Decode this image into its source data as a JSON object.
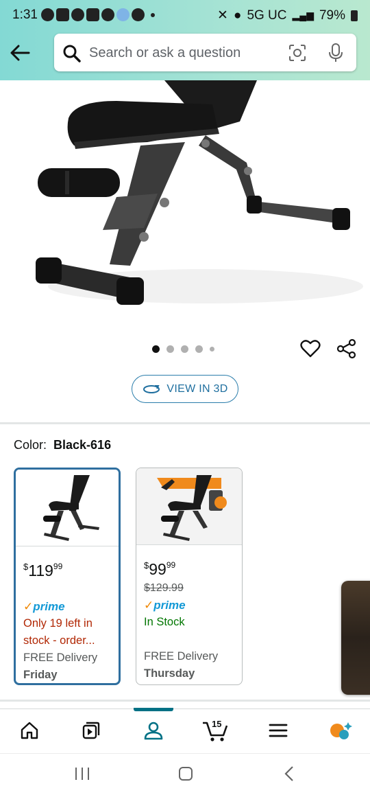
{
  "status_bar": {
    "time": "1:31",
    "network": "5G UC",
    "battery": "79%"
  },
  "search": {
    "placeholder": "Search or ask a question"
  },
  "gallery": {
    "image_count": 5,
    "active_index": 0
  },
  "view_3d_label": "VIEW IN 3D",
  "color": {
    "label": "Color:",
    "value": "Black-616"
  },
  "variants": [
    {
      "selected": true,
      "price_symbol": "$",
      "price_whole": "119",
      "price_fraction": "99",
      "list_price": "",
      "prime": "prime",
      "availability": "Only 19 left in stock - order...",
      "delivery_label": "FREE Delivery",
      "delivery_day": "Friday"
    },
    {
      "selected": false,
      "price_symbol": "$",
      "price_whole": "99",
      "price_fraction": "99",
      "list_price": "$129.99",
      "prime": "prime",
      "availability": "In Stock",
      "delivery_label": "FREE Delivery",
      "delivery_day": "Thursday"
    }
  ],
  "bottom_nav": {
    "cart_count": "15",
    "active": "account"
  },
  "colors": {
    "header_start": "#83d9d4",
    "header_end": "#b9e8cf",
    "link_blue": "#1f6f9f",
    "prime_blue": "#1399d6",
    "low_stock_red": "#b12704",
    "in_stock_green": "#007600",
    "nav_active": "#007185"
  }
}
